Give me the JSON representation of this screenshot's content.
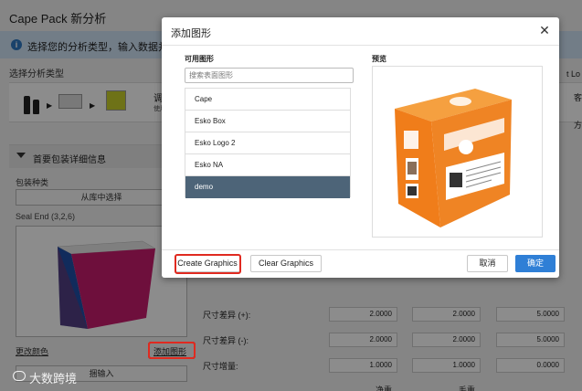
{
  "app": {
    "title": "Cape Pack 新分析",
    "banner_icon": "info-icon",
    "banner_text": "选择您的分析类型，输入数据并",
    "section_title": "选择分析类型",
    "step_adjust_label": "调整",
    "step_adjust_sub": "使用可",
    "right_cut_1": "t Lo",
    "right_cut_2": "客",
    "right_cut_3": "方"
  },
  "package": {
    "section_label": "首要包装详细信息",
    "type_label": "包装种类",
    "library_button": "从库中选择",
    "seal_label": "Seal End (3,2,6)",
    "change_color_label": "更改颜色",
    "add_graphic_label": "添加图形",
    "import_label": "捆输入"
  },
  "dimensions": {
    "rows": [
      {
        "label": "尺寸差异 (+):",
        "values": [
          "2.0000",
          "2.0000",
          "5.0000"
        ]
      },
      {
        "label": "尺寸差异 (-):",
        "values": [
          "2.0000",
          "2.0000",
          "5.0000"
        ]
      },
      {
        "label": "尺寸增量:",
        "values": [
          "1.0000",
          "1.0000",
          "0.0000"
        ]
      }
    ],
    "footer_labels": [
      "净重",
      "毛重"
    ]
  },
  "dialog": {
    "title": "添加图形",
    "close_icon": "close-icon",
    "available_label": "可用图形",
    "preview_label": "预览",
    "search_placeholder": "搜索表面图形",
    "graphics": [
      "Cape",
      "Esko Box",
      "Esko Logo 2",
      "Esko NA",
      "demo"
    ],
    "selected": "demo",
    "create_button": "Create Graphics",
    "clear_button": "Clear Graphics",
    "cancel_button": "取消",
    "ok_button": "确定"
  },
  "watermark": "大数跨境",
  "colors": {
    "accent": "#2f7fd6",
    "selected_row": "#4d6478",
    "highlight": "#e02a20",
    "box_orange": "#f07d1a"
  }
}
